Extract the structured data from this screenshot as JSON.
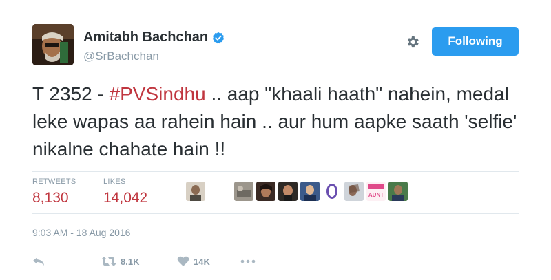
{
  "user": {
    "display_name": "Amitabh Bachchan",
    "handle": "@SrBachchan",
    "verified": true
  },
  "follow_button": {
    "label": "Following"
  },
  "tweet": {
    "text_before": "T 2352 - ",
    "hashtag": "#PVSindhu",
    "text_after": " .. aap \"khaali haath\" nahein, medal leke wapas aa rahein hain .. aur hum aapke saath 'selfie' nikalne chahate hain !!"
  },
  "stats": {
    "retweets_label": "RETWEETS",
    "retweets_value": "8,130",
    "likes_label": "LIKES",
    "likes_value": "14,042"
  },
  "liked_by": [
    {
      "name": "liker-avatar-1"
    },
    {
      "name": "liker-avatar-2"
    },
    {
      "name": "liker-avatar-3"
    },
    {
      "name": "liker-avatar-4"
    },
    {
      "name": "liker-avatar-5"
    },
    {
      "name": "liker-avatar-6"
    },
    {
      "name": "liker-avatar-7"
    },
    {
      "name": "liker-avatar-8",
      "text": "AUNT"
    },
    {
      "name": "liker-avatar-9"
    }
  ],
  "timestamp": "9:03 AM - 18 Aug 2016",
  "actions": {
    "retweet_count": "8.1K",
    "like_count": "14K"
  },
  "colors": {
    "accent": "#2b9cef",
    "hashtag": "#c0363f",
    "muted": "#8899a6"
  }
}
